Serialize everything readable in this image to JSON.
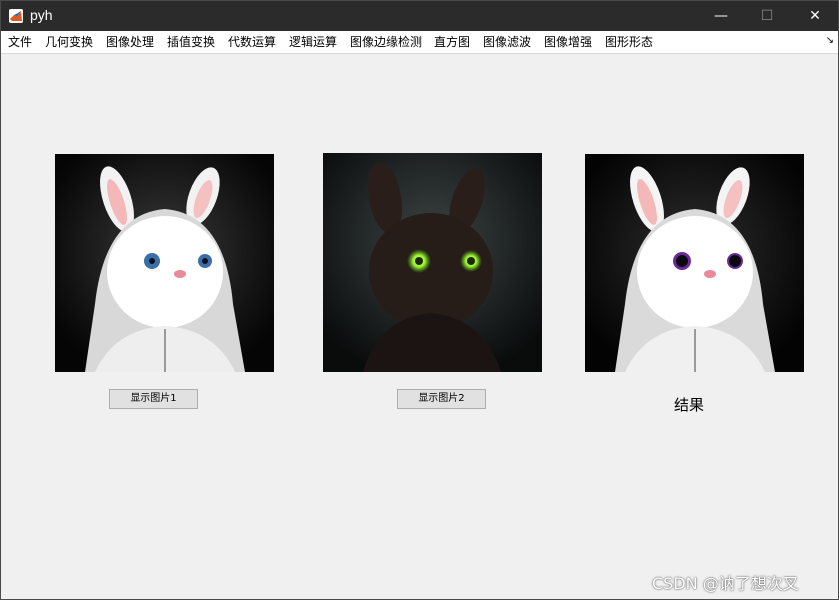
{
  "window": {
    "title": "pyh",
    "controls": {
      "minimize": "—",
      "maximize": "☐",
      "close": "✕"
    }
  },
  "menu": {
    "items": [
      "文件",
      "几何变换",
      "图像处理",
      "插值变换",
      "代数运算",
      "逻辑运算",
      "图像边缘检测",
      "直方图",
      "图像滤波",
      "图像增强",
      "图形形态"
    ],
    "corner_glyph": "↘"
  },
  "images": [
    {
      "icon": "white-rabbit-image",
      "eye_color": "#3a6ea8"
    },
    {
      "icon": "dark-rabbit-image",
      "eye_color": "#b8ff3c"
    },
    {
      "icon": "result-rabbit-image",
      "eye_color": "#6a2a9a"
    }
  ],
  "buttons": {
    "show_image1": "显示图片1",
    "show_image2": "显示图片2"
  },
  "result_label": "结果",
  "watermark": "CSDN @讷了想次叉"
}
